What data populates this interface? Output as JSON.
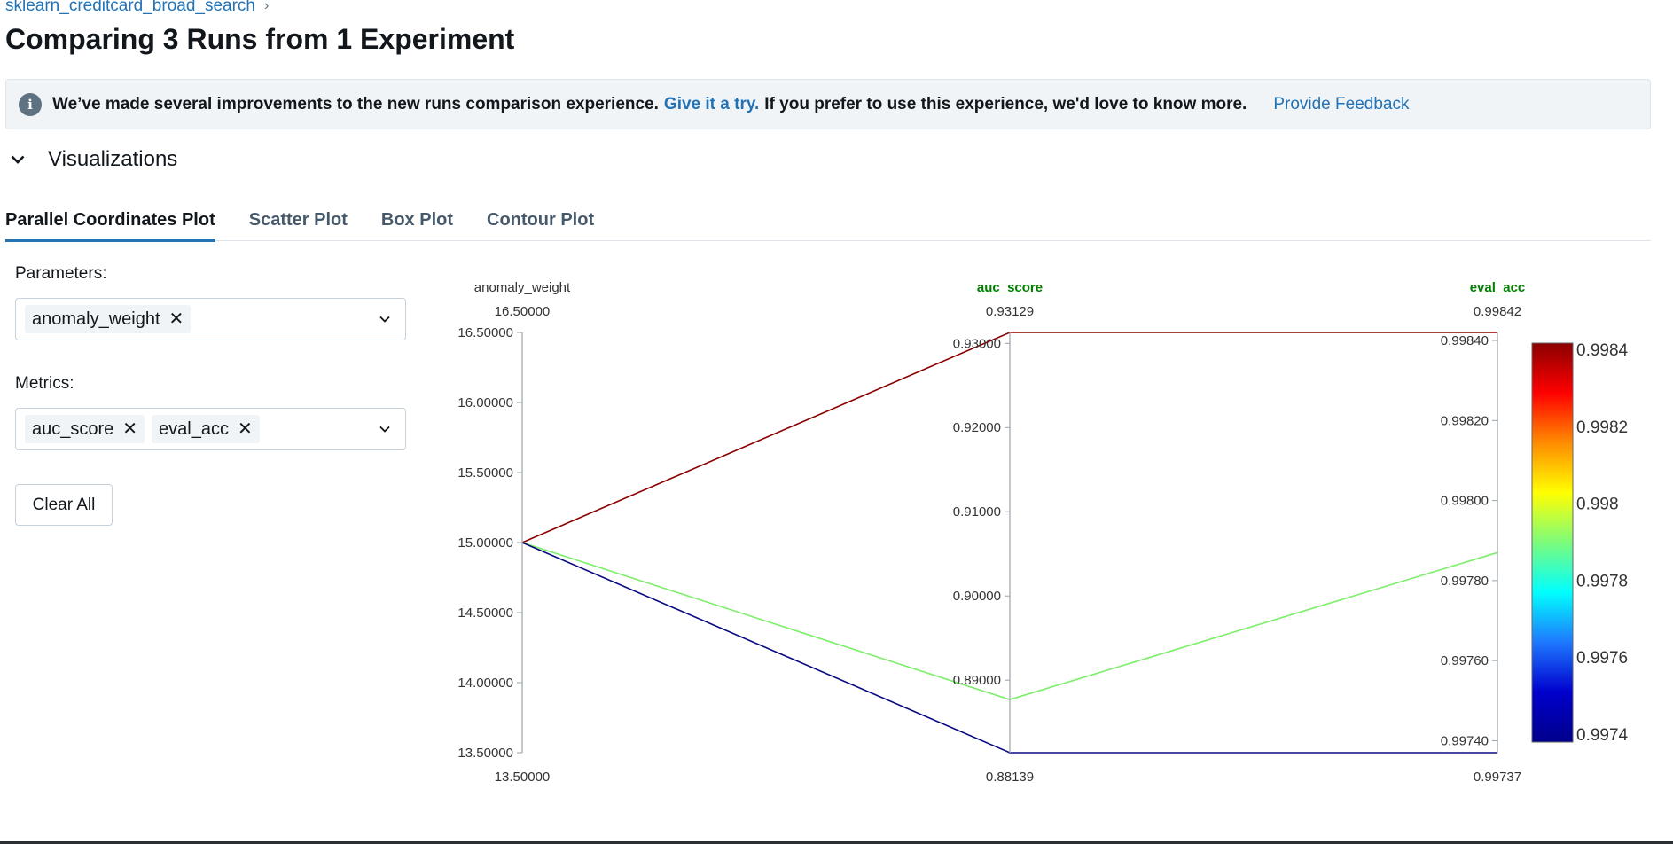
{
  "breadcrumb": {
    "experiment": "sklearn_creditcard_broad_search",
    "separator": "›"
  },
  "title": "Comparing 3 Runs from 1 Experiment",
  "banner": {
    "text_before": "We’ve made several improvements to the new runs comparison experience.",
    "link_text": "Give it a try.",
    "text_after": "If you prefer to use this experience, we'd love to know more.",
    "feedback_link": "Provide Feedback"
  },
  "visualizations": {
    "label": "Visualizations"
  },
  "tabs": [
    {
      "label": "Parallel Coordinates Plot",
      "active": true
    },
    {
      "label": "Scatter Plot",
      "active": false
    },
    {
      "label": "Box Plot",
      "active": false
    },
    {
      "label": "Contour Plot",
      "active": false
    }
  ],
  "controls": {
    "parameters_label": "Parameters:",
    "parameters": [
      "anomaly_weight"
    ],
    "metrics_label": "Metrics:",
    "metrics": [
      "auc_score",
      "eval_acc"
    ],
    "clear_all": "Clear All"
  },
  "chart_data": {
    "type": "parallel_coordinates",
    "axes": [
      {
        "name": "anomaly_weight",
        "kind": "parameter",
        "range": [
          13.5,
          16.5
        ],
        "top_label": "16.50000",
        "bottom_label": "13.50000",
        "ticks": [
          "16.50000",
          "16.00000",
          "15.50000",
          "15.00000",
          "14.50000",
          "14.00000",
          "13.50000"
        ],
        "tick_values": [
          16.5,
          16.0,
          15.5,
          15.0,
          14.5,
          14.0,
          13.5
        ]
      },
      {
        "name": "auc_score",
        "kind": "metric",
        "range": [
          0.88139,
          0.93129
        ],
        "top_label": "0.93129",
        "bottom_label": "0.88139",
        "ticks": [
          "0.93000",
          "0.92000",
          "0.91000",
          "0.90000",
          "0.89000"
        ],
        "tick_values": [
          0.93,
          0.92,
          0.91,
          0.9,
          0.89
        ]
      },
      {
        "name": "eval_acc",
        "kind": "metric",
        "range": [
          0.99737,
          0.99842
        ],
        "top_label": "0.99842",
        "bottom_label": "0.99737",
        "ticks": [
          "0.99840",
          "0.99820",
          "0.99800",
          "0.99780",
          "0.99760",
          "0.99740"
        ],
        "tick_values": [
          0.9984,
          0.9982,
          0.998,
          0.9978,
          0.9976,
          0.9974
        ]
      }
    ],
    "runs": [
      {
        "values": [
          15.0,
          0.93129,
          0.99842
        ],
        "color": "#8b0000"
      },
      {
        "values": [
          15.0,
          0.8877,
          0.99787
        ],
        "color": "#7cee6a"
      },
      {
        "values": [
          15.0,
          0.88139,
          0.99737
        ],
        "color": "#0a0a80"
      }
    ],
    "colorscale": {
      "ticks": [
        "0.9984",
        "0.9982",
        "0.998",
        "0.9978",
        "0.9976",
        "0.9974"
      ],
      "tick_values": [
        0.9984,
        0.9982,
        0.998,
        0.9978,
        0.9976,
        0.9974
      ],
      "range": [
        0.99737,
        0.99842
      ],
      "colors": [
        "#8b0000",
        "#ff0000",
        "#ff8c00",
        "#ffff00",
        "#7cfc7c",
        "#00ffff",
        "#1e78ff",
        "#0000cd",
        "#00008b"
      ]
    },
    "axis_label_color_metric": "#008000",
    "axis_label_color_param": "#333333"
  }
}
